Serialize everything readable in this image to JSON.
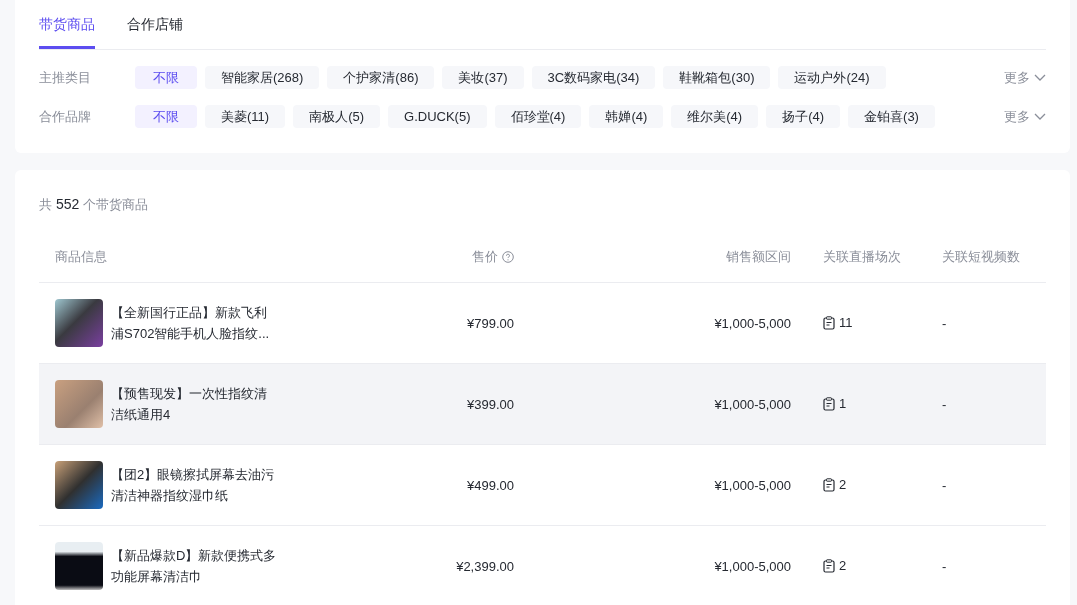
{
  "tabs": [
    {
      "label": "带货商品",
      "selected": true
    },
    {
      "label": "合作店铺",
      "selected": false
    }
  ],
  "filters": [
    {
      "label": "主推类目",
      "options": [
        {
          "label": "不限",
          "selected": true
        },
        {
          "label": "智能家居(268)",
          "selected": false
        },
        {
          "label": "个护家清(86)",
          "selected": false
        },
        {
          "label": "美妆(37)",
          "selected": false
        },
        {
          "label": "3C数码家电(34)",
          "selected": false
        },
        {
          "label": "鞋靴箱包(30)",
          "selected": false
        },
        {
          "label": "运动户外(24)",
          "selected": false
        }
      ],
      "more": "更多"
    },
    {
      "label": "合作品牌",
      "options": [
        {
          "label": "不限",
          "selected": true
        },
        {
          "label": "美菱(11)",
          "selected": false
        },
        {
          "label": "南极人(5)",
          "selected": false
        },
        {
          "label": "G.DUCK(5)",
          "selected": false
        },
        {
          "label": "佰珍堂(4)",
          "selected": false
        },
        {
          "label": "韩婵(4)",
          "selected": false
        },
        {
          "label": "维尔美(4)",
          "selected": false
        },
        {
          "label": "扬子(4)",
          "selected": false
        },
        {
          "label": "金铂喜(3)",
          "selected": false
        }
      ],
      "more": "更多"
    }
  ],
  "summary": {
    "prefix": "共",
    "count": "552",
    "suffix": "个带货商品"
  },
  "table": {
    "columns": [
      "商品信息",
      "售价",
      "销售额区间",
      "关联直播场次",
      "关联短视频数"
    ],
    "rows": [
      {
        "title": "【全新国行正品】新款飞利浦S702智能手机人脸指纹...",
        "price": "¥799.00",
        "sales_range": "¥1,000-5,000",
        "live_sessions": "11",
        "short_videos": "-",
        "hovered": false
      },
      {
        "title": "【预售现发】一次性指纹清洁纸通用4",
        "price": "¥399.00",
        "sales_range": "¥1,000-5,000",
        "live_sessions": "1",
        "short_videos": "-",
        "hovered": true
      },
      {
        "title": "【团2】眼镜擦拭屏幕去油污清洁神器指纹湿巾纸",
        "price": "¥499.00",
        "sales_range": "¥1,000-5,000",
        "live_sessions": "2",
        "short_videos": "-",
        "hovered": false
      },
      {
        "title": "【新品爆款D】新款便携式多功能屏幕清洁巾",
        "price": "¥2,399.00",
        "sales_range": "¥1,000-5,000",
        "live_sessions": "2",
        "short_videos": "-",
        "hovered": false
      }
    ]
  }
}
